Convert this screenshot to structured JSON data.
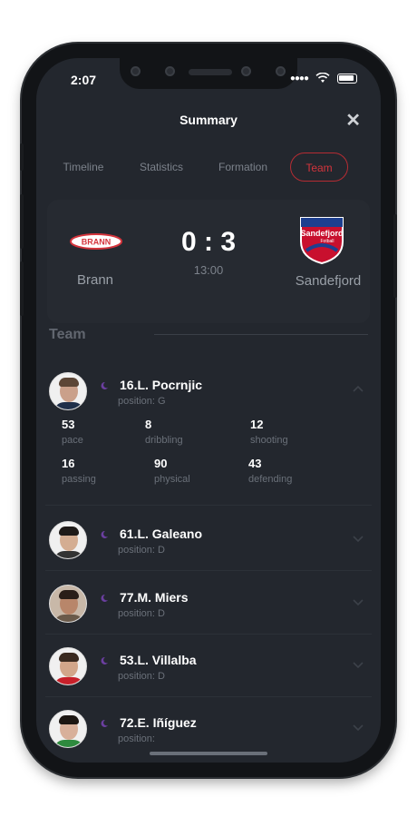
{
  "status_bar": {
    "time": "2:07"
  },
  "header": {
    "title": "Summary",
    "close_symbol": "✕"
  },
  "tabs": [
    {
      "label": "Timeline",
      "active": false
    },
    {
      "label": "Statistics",
      "active": false
    },
    {
      "label": "Formation",
      "active": false
    },
    {
      "label": "Team",
      "active": true
    }
  ],
  "match": {
    "home_team": "Brann",
    "home_logo_text": "BRANN",
    "away_team": "Sandefjord",
    "away_logo_text": "Sandefjord",
    "away_logo_subtext": "Fotball",
    "score": "0 : 3",
    "kickoff": "13:00"
  },
  "section": {
    "title": "Team"
  },
  "players": [
    {
      "name": "16.L. Pocrnjic",
      "position": "position: G",
      "expanded": true,
      "stats": [
        {
          "value": "53",
          "label": "pace"
        },
        {
          "value": "8",
          "label": "dribbling"
        },
        {
          "value": "12",
          "label": "shooting"
        },
        {
          "value": "16",
          "label": "passing"
        },
        {
          "value": "90",
          "label": "physical"
        },
        {
          "value": "43",
          "label": "defending"
        }
      ]
    },
    {
      "name": "61.L. Galeano",
      "position": "position: D",
      "expanded": false
    },
    {
      "name": "77.M. Miers",
      "position": "position: D",
      "expanded": false
    },
    {
      "name": "53.L. Villalba",
      "position": "position: D",
      "expanded": false
    },
    {
      "name": "72.E. Iñíguez",
      "position": "position:",
      "expanded": false
    }
  ],
  "colors": {
    "accent": "#d4343c",
    "background": "#23272e",
    "moon": "#6b3fa0"
  }
}
